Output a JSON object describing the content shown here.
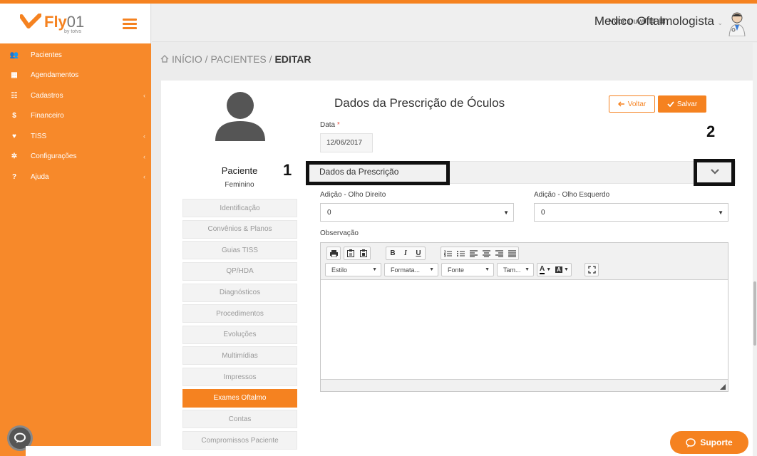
{
  "app": {
    "logo_text": "Fly",
    "logo_suffix": "01",
    "logo_sub": "by totvs"
  },
  "sidebar": {
    "items": [
      {
        "label": "Pacientes",
        "icon": "users-icon",
        "glyph": "👥",
        "has_children": false
      },
      {
        "label": "Agendamentos",
        "icon": "calendar-icon",
        "glyph": "▦",
        "has_children": false
      },
      {
        "label": "Cadastros",
        "icon": "list-icon",
        "glyph": "☷",
        "has_children": true
      },
      {
        "label": "Financeiro",
        "icon": "dollar-icon",
        "glyph": "$",
        "has_children": false
      },
      {
        "label": "TISS",
        "icon": "heartbeat-icon",
        "glyph": "♥",
        "has_children": true
      },
      {
        "label": "Configurações",
        "icon": "gear-icon",
        "glyph": "✲",
        "has_children": true
      },
      {
        "label": "Ajuda",
        "icon": "question-icon",
        "glyph": "?",
        "has_children": true
      }
    ]
  },
  "header": {
    "user_name": "Nylce Duval",
    "flags": "▤ ▦",
    "role": "Medico Oftalmologista",
    "caret": "⌄"
  },
  "breadcrumb": {
    "home": "INÍCIO",
    "sep1": " / ",
    "section": "PACIENTES",
    "sep2": " / ",
    "current": "EDITAR"
  },
  "patient": {
    "label": "Paciente",
    "gender": "Feminino"
  },
  "side_nav": [
    {
      "label": "Identificação",
      "active": false
    },
    {
      "label": "Convênios & Planos",
      "active": false
    },
    {
      "label": "Guias TISS",
      "active": false
    },
    {
      "label": "QP/HDA",
      "active": false
    },
    {
      "label": "Diagnósticos",
      "active": false
    },
    {
      "label": "Procedimentos",
      "active": false
    },
    {
      "label": "Evoluções",
      "active": false
    },
    {
      "label": "Multimídias",
      "active": false
    },
    {
      "label": "Impressos",
      "active": false
    },
    {
      "label": "Exames Oftalmo",
      "active": true
    },
    {
      "label": "Contas",
      "active": false
    },
    {
      "label": "Compromissos Paciente",
      "active": false
    }
  ],
  "form": {
    "title": "Dados da Prescrição de Óculos",
    "voltar_label": "Voltar",
    "salvar_label": "Salvar",
    "data_label": "Data",
    "data_required": "*",
    "data_value": "12/06/2017",
    "section_label": "Dados da Prescrição",
    "add_od_label": "Adição - Olho Direito",
    "add_od_value": "0",
    "add_oe_label": "Adição - Olho Esquerdo",
    "add_oe_value": "0",
    "obs_label": "Observação"
  },
  "annotations": {
    "num1": "1",
    "num2": "2"
  },
  "editor": {
    "combo_style": "Estilo",
    "combo_format": "Formata...",
    "combo_font": "Fonte",
    "combo_size": "Tam..."
  },
  "support": {
    "label": "Suporte"
  },
  "colors": {
    "brand": "#f58220",
    "sidebar": "#f7892a"
  }
}
